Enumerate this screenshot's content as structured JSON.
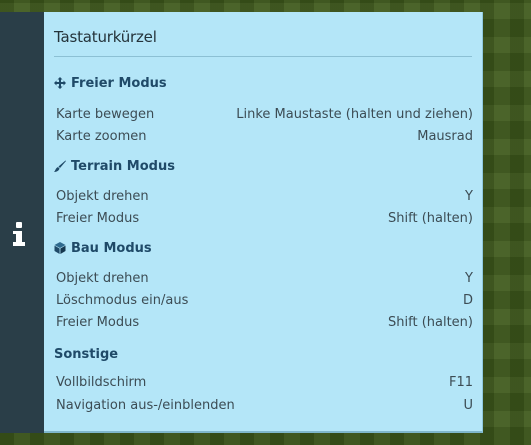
{
  "panel": {
    "title": "Tastaturkürzel"
  },
  "sections": [
    {
      "title": "Freier Modus",
      "icon": "move-arrows-icon",
      "rows": [
        {
          "label": "Karte bewegen",
          "key": "Linke Maustaste (halten und ziehen)"
        },
        {
          "label": "Karte zoomen",
          "key": "Mausrad"
        }
      ]
    },
    {
      "title": "Terrain Modus",
      "icon": "brush-icon",
      "rows": [
        {
          "label": "Objekt drehen",
          "key": "Y"
        },
        {
          "label": "Freier Modus",
          "key": "Shift (halten)"
        }
      ]
    },
    {
      "title": "Bau Modus",
      "icon": "cube-icon",
      "rows": [
        {
          "label": "Objekt drehen",
          "key": "Y"
        },
        {
          "label": "Löschmodus ein/aus",
          "key": "D"
        },
        {
          "label": "Freier Modus",
          "key": "Shift (halten)"
        }
      ]
    },
    {
      "title": "Sonstige",
      "icon": "",
      "rows": [
        {
          "label": "Vollbildschirm",
          "key": "F11"
        },
        {
          "label": "Navigation aus-/einblenden",
          "key": "U"
        }
      ]
    }
  ],
  "colors": {
    "panel_background": "#b4e6f8",
    "section_heading": "#1f4a68",
    "side_panel": "#2a3e48"
  }
}
